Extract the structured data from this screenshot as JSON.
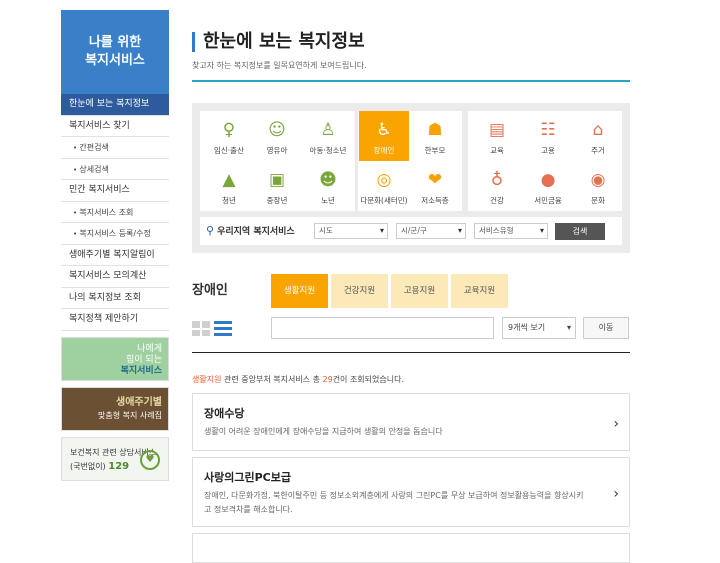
{
  "sidebar": {
    "heading_line1": "나를 위한",
    "heading_line2": "복지서비스",
    "items": [
      {
        "label": "한눈에 보는 복지정보",
        "type": "active"
      },
      {
        "label": "복지서비스 찾기",
        "type": "main"
      },
      {
        "label": "간편검색",
        "type": "sub"
      },
      {
        "label": "상세검색",
        "type": "sub"
      },
      {
        "label": "민간 복지서비스",
        "type": "main"
      },
      {
        "label": "복지서비스 조회",
        "type": "sub"
      },
      {
        "label": "복지서비스 등록/수정",
        "type": "sub"
      },
      {
        "label": "생애주기별 복지알림이",
        "type": "main"
      },
      {
        "label": "복지서비스 모의계산",
        "type": "main"
      },
      {
        "label": "나의 복지정보 조회",
        "type": "main"
      },
      {
        "label": "복지정책 제안하기",
        "type": "main"
      }
    ],
    "banner1": {
      "line1": "나에게",
      "line2": "힘이 되는",
      "line3": "복지서비스"
    },
    "banner2": {
      "line1": "생애주기별",
      "line2": "맞춤형 복지 사례집"
    },
    "banner3": {
      "line1": "보건복지 관련 상담서비스",
      "line2": "(국번없이)",
      "number": "129"
    }
  },
  "page": {
    "title": "한눈에 보는 복지정보",
    "subtitle": "찾고자 하는 복지정보를 일목요연하게 보여드립니다."
  },
  "categories": [
    {
      "label": "임신·출산",
      "icon": "pregnancy-icon",
      "color": "green",
      "glyph": "♀"
    },
    {
      "label": "영유아",
      "icon": "baby-icon",
      "color": "green",
      "glyph": "☺"
    },
    {
      "label": "아동·청소년",
      "icon": "child-icon",
      "color": "green",
      "glyph": "♙"
    },
    {
      "label": "장애인",
      "icon": "wheelchair-icon",
      "color": "sel",
      "glyph": "♿"
    },
    {
      "label": "한부모",
      "icon": "family-icon",
      "color": "orange",
      "glyph": "☗"
    },
    {
      "label": "교육",
      "icon": "book-icon",
      "color": "red",
      "glyph": "▤"
    },
    {
      "label": "고용",
      "icon": "people-icon",
      "color": "red",
      "glyph": "☷"
    },
    {
      "label": "주거",
      "icon": "house-icon",
      "color": "red",
      "glyph": "⌂"
    },
    {
      "label": "청년",
      "icon": "graduation-cap-icon",
      "color": "green",
      "glyph": "▲"
    },
    {
      "label": "중장년",
      "icon": "briefcase-icon",
      "color": "green",
      "glyph": "▣"
    },
    {
      "label": "노년",
      "icon": "elderly-icon",
      "color": "green",
      "glyph": "☻"
    },
    {
      "label": "다문화(새터민)",
      "icon": "globe-icon",
      "color": "orange",
      "glyph": "◎"
    },
    {
      "label": "저소득층",
      "icon": "hands-heart-icon",
      "color": "orange",
      "glyph": "❤"
    },
    {
      "label": "건강",
      "icon": "stethoscope-icon",
      "color": "red",
      "glyph": "♁"
    },
    {
      "label": "서민금융",
      "icon": "piggy-bank-icon",
      "color": "red",
      "glyph": "●"
    },
    {
      "label": "문화",
      "icon": "film-reel-icon",
      "color": "red",
      "glyph": "◉"
    }
  ],
  "region_search": {
    "label": "우리지역 복지서비스",
    "sido": "시도",
    "sigungu": "시/군/구",
    "service_type": "서비스유형",
    "button": "검색"
  },
  "section": {
    "title": "장애인",
    "tabs": [
      "생활지원",
      "건강지원",
      "고용지원",
      "교육지원"
    ],
    "active_tab": "생활지원"
  },
  "filter": {
    "keyword_value": "",
    "per_page": "9개씩 보기",
    "move_button": "이동"
  },
  "result": {
    "category": "생활지원",
    "text_before": " 관련 중앙부처 복지서비스 총 ",
    "count": "29",
    "text_after": "건이 조회되었습니다."
  },
  "cards": [
    {
      "title": "장애수당",
      "desc": "생활이 어려운 장애인에게 장애수당을 지급하여 생활의 안정을 돕습니다"
    },
    {
      "title": "사랑의그린PC보급",
      "desc": "장애인, 다문화가정, 북한이탈주민 등 정보소외계층에게 사랑의 그린PC를 무상 보급하여 정보활용능력을 향상시키고 정보격차를 해소합니다."
    }
  ]
}
